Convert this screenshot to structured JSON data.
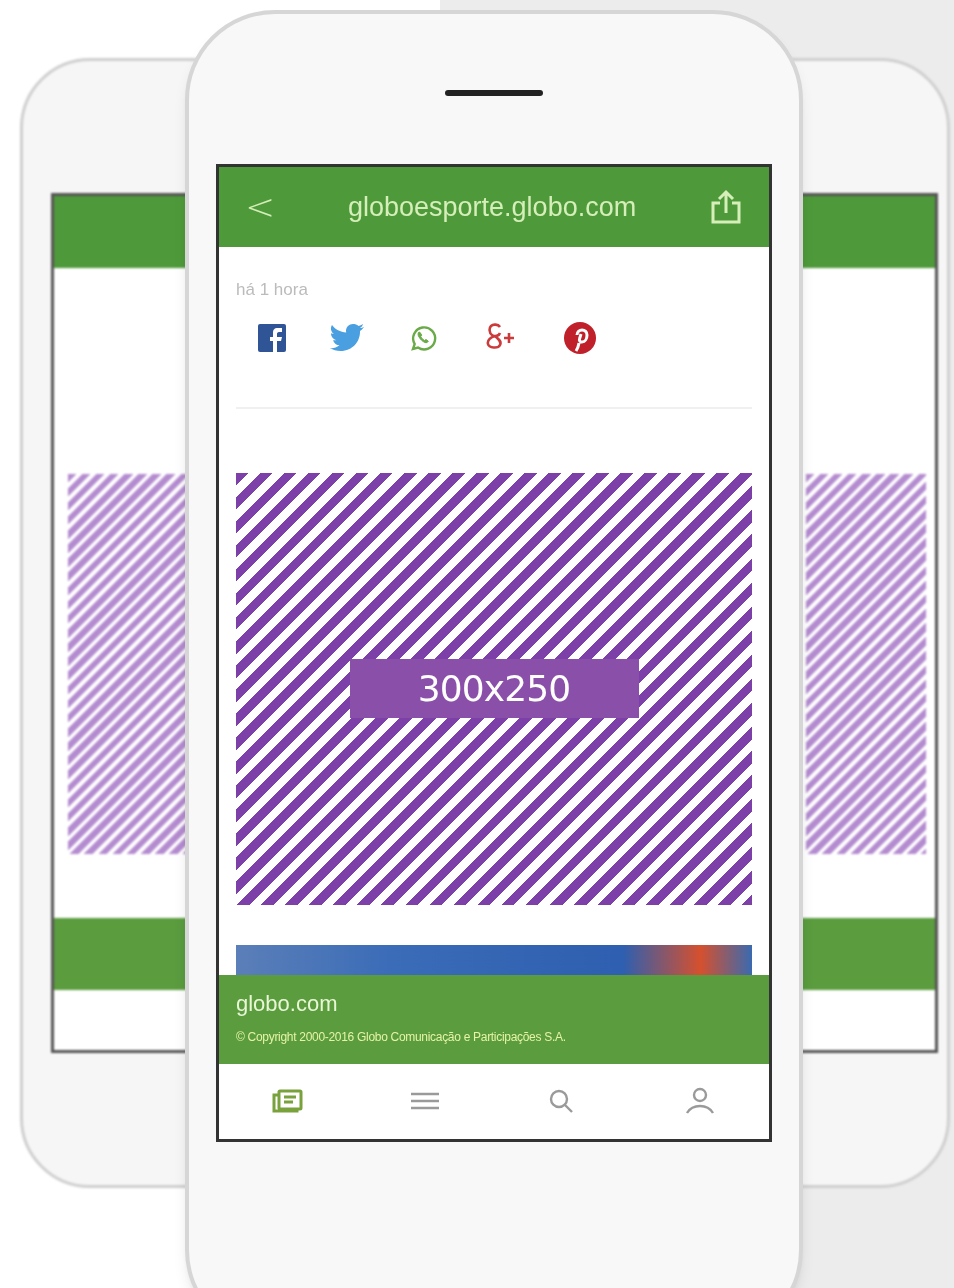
{
  "header": {
    "back": "<",
    "title": "globoesporte.globo.com"
  },
  "article": {
    "timestamp": "há 1 hora"
  },
  "ad": {
    "label": "300x250"
  },
  "footer": {
    "brand": "globo.com",
    "copyright": "© Copyright 2000-2016 Globo Comunicação e Participações S.A."
  },
  "tab_bar": [
    {
      "selected": true
    },
    {
      "selected": false
    },
    {
      "selected": false
    },
    {
      "selected": false
    }
  ]
}
